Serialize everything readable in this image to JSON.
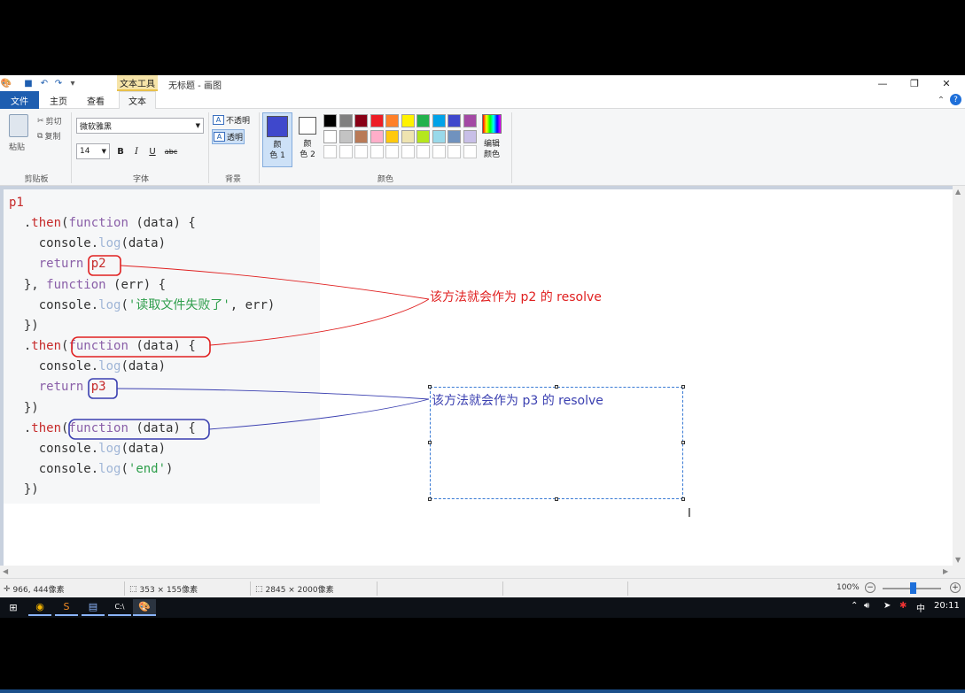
{
  "window": {
    "title": "无标题 - 画图",
    "context_tab": "文本工具",
    "minimize": "—",
    "restore": "❐",
    "close": "✕"
  },
  "tabs": {
    "file": "文件",
    "home": "主页",
    "view": "查看",
    "text": "文本"
  },
  "ribbon": {
    "clipboard": {
      "paste": "粘贴",
      "cut": "剪切",
      "copy": "复制",
      "label": "剪贴板"
    },
    "font": {
      "family": "微软雅黑",
      "size": "14",
      "bold": "B",
      "italic": "I",
      "underline": "U",
      "strike": "abc",
      "label": "字体"
    },
    "background": {
      "opaque": "不透明",
      "transparent": "透明",
      "label": "背景"
    },
    "colors": {
      "color1_label": "颜\n色 1",
      "color2_label": "颜\n色 2",
      "edit_label": "编辑\n颜色",
      "label": "颜色",
      "color1": "#3f48cc",
      "color2": "#ffffff",
      "palette_row1": [
        "#000000",
        "#7f7f7f",
        "#880015",
        "#ed1c24",
        "#ff7f27",
        "#fff200",
        "#22b14c",
        "#00a2e8",
        "#3f48cc",
        "#a349a4"
      ],
      "palette_row2": [
        "#ffffff",
        "#c3c3c3",
        "#b97a57",
        "#ffaec9",
        "#ffc90e",
        "#efe4b0",
        "#b5e61d",
        "#99d9ea",
        "#7092be",
        "#c8bfe7"
      ]
    }
  },
  "canvas": {
    "code_lines": [
      [
        {
          "t": "p1",
          "c": "k-red"
        }
      ],
      [
        {
          "t": "  .",
          "c": "k-plain"
        },
        {
          "t": "then",
          "c": "k-red"
        },
        {
          "t": "(",
          "c": "k-plain"
        },
        {
          "t": "function",
          "c": "k-purple"
        },
        {
          "t": " (data) {",
          "c": "k-plain"
        }
      ],
      [
        {
          "t": "    console.",
          "c": "k-plain"
        },
        {
          "t": "log",
          "c": "k-dim"
        },
        {
          "t": "(data)",
          "c": "k-plain"
        }
      ],
      [
        {
          "t": "    ",
          "c": "k-plain"
        },
        {
          "t": "return",
          "c": "k-purple"
        },
        {
          "t": " ",
          "c": "k-plain"
        },
        {
          "t": "p2",
          "c": "k-red"
        }
      ],
      [
        {
          "t": "  }, ",
          "c": "k-plain"
        },
        {
          "t": "function",
          "c": "k-purple"
        },
        {
          "t": " (err) {",
          "c": "k-plain"
        }
      ],
      [
        {
          "t": "    console.",
          "c": "k-plain"
        },
        {
          "t": "log",
          "c": "k-dim"
        },
        {
          "t": "(",
          "c": "k-plain"
        },
        {
          "t": "'读取文件失败了'",
          "c": "k-green"
        },
        {
          "t": ", err)",
          "c": "k-plain"
        }
      ],
      [
        {
          "t": "  })",
          "c": "k-plain"
        }
      ],
      [
        {
          "t": "  .",
          "c": "k-plain"
        },
        {
          "t": "then",
          "c": "k-red"
        },
        {
          "t": "(",
          "c": "k-plain"
        },
        {
          "t": "function",
          "c": "k-purple"
        },
        {
          "t": " (data) {",
          "c": "k-plain"
        }
      ],
      [
        {
          "t": "    console.",
          "c": "k-plain"
        },
        {
          "t": "log",
          "c": "k-dim"
        },
        {
          "t": "(data)",
          "c": "k-plain"
        }
      ],
      [
        {
          "t": "    ",
          "c": "k-plain"
        },
        {
          "t": "return",
          "c": "k-purple"
        },
        {
          "t": " ",
          "c": "k-plain"
        },
        {
          "t": "p3",
          "c": "k-red"
        }
      ],
      [
        {
          "t": "  })",
          "c": "k-plain"
        }
      ],
      [
        {
          "t": "  .",
          "c": "k-plain"
        },
        {
          "t": "then",
          "c": "k-red"
        },
        {
          "t": "(",
          "c": "k-plain"
        },
        {
          "t": "function",
          "c": "k-purple"
        },
        {
          "t": " (data) {",
          "c": "k-plain"
        }
      ],
      [
        {
          "t": "    console.",
          "c": "k-plain"
        },
        {
          "t": "log",
          "c": "k-dim"
        },
        {
          "t": "(data)",
          "c": "k-plain"
        }
      ],
      [
        {
          "t": "    console.",
          "c": "k-plain"
        },
        {
          "t": "log",
          "c": "k-dim"
        },
        {
          "t": "(",
          "c": "k-plain"
        },
        {
          "t": "'end'",
          "c": "k-green"
        },
        {
          "t": ")",
          "c": "k-plain"
        }
      ],
      [
        {
          "t": "  })",
          "c": "k-plain"
        }
      ]
    ],
    "annotation_red": "该方法就会作为 p2 的 resolve",
    "annotation_blue": "该方法就会作为 p3 的 resolve",
    "red_color": "#e02020",
    "blue_color": "#3a3fb0"
  },
  "status": {
    "cursor_pos": "966, 444像素",
    "selection_size": "353 × 155像素",
    "image_size": "2845 × 2000像素",
    "zoom": "100%"
  },
  "taskbar": {
    "ime": "中",
    "time": "20:11"
  }
}
